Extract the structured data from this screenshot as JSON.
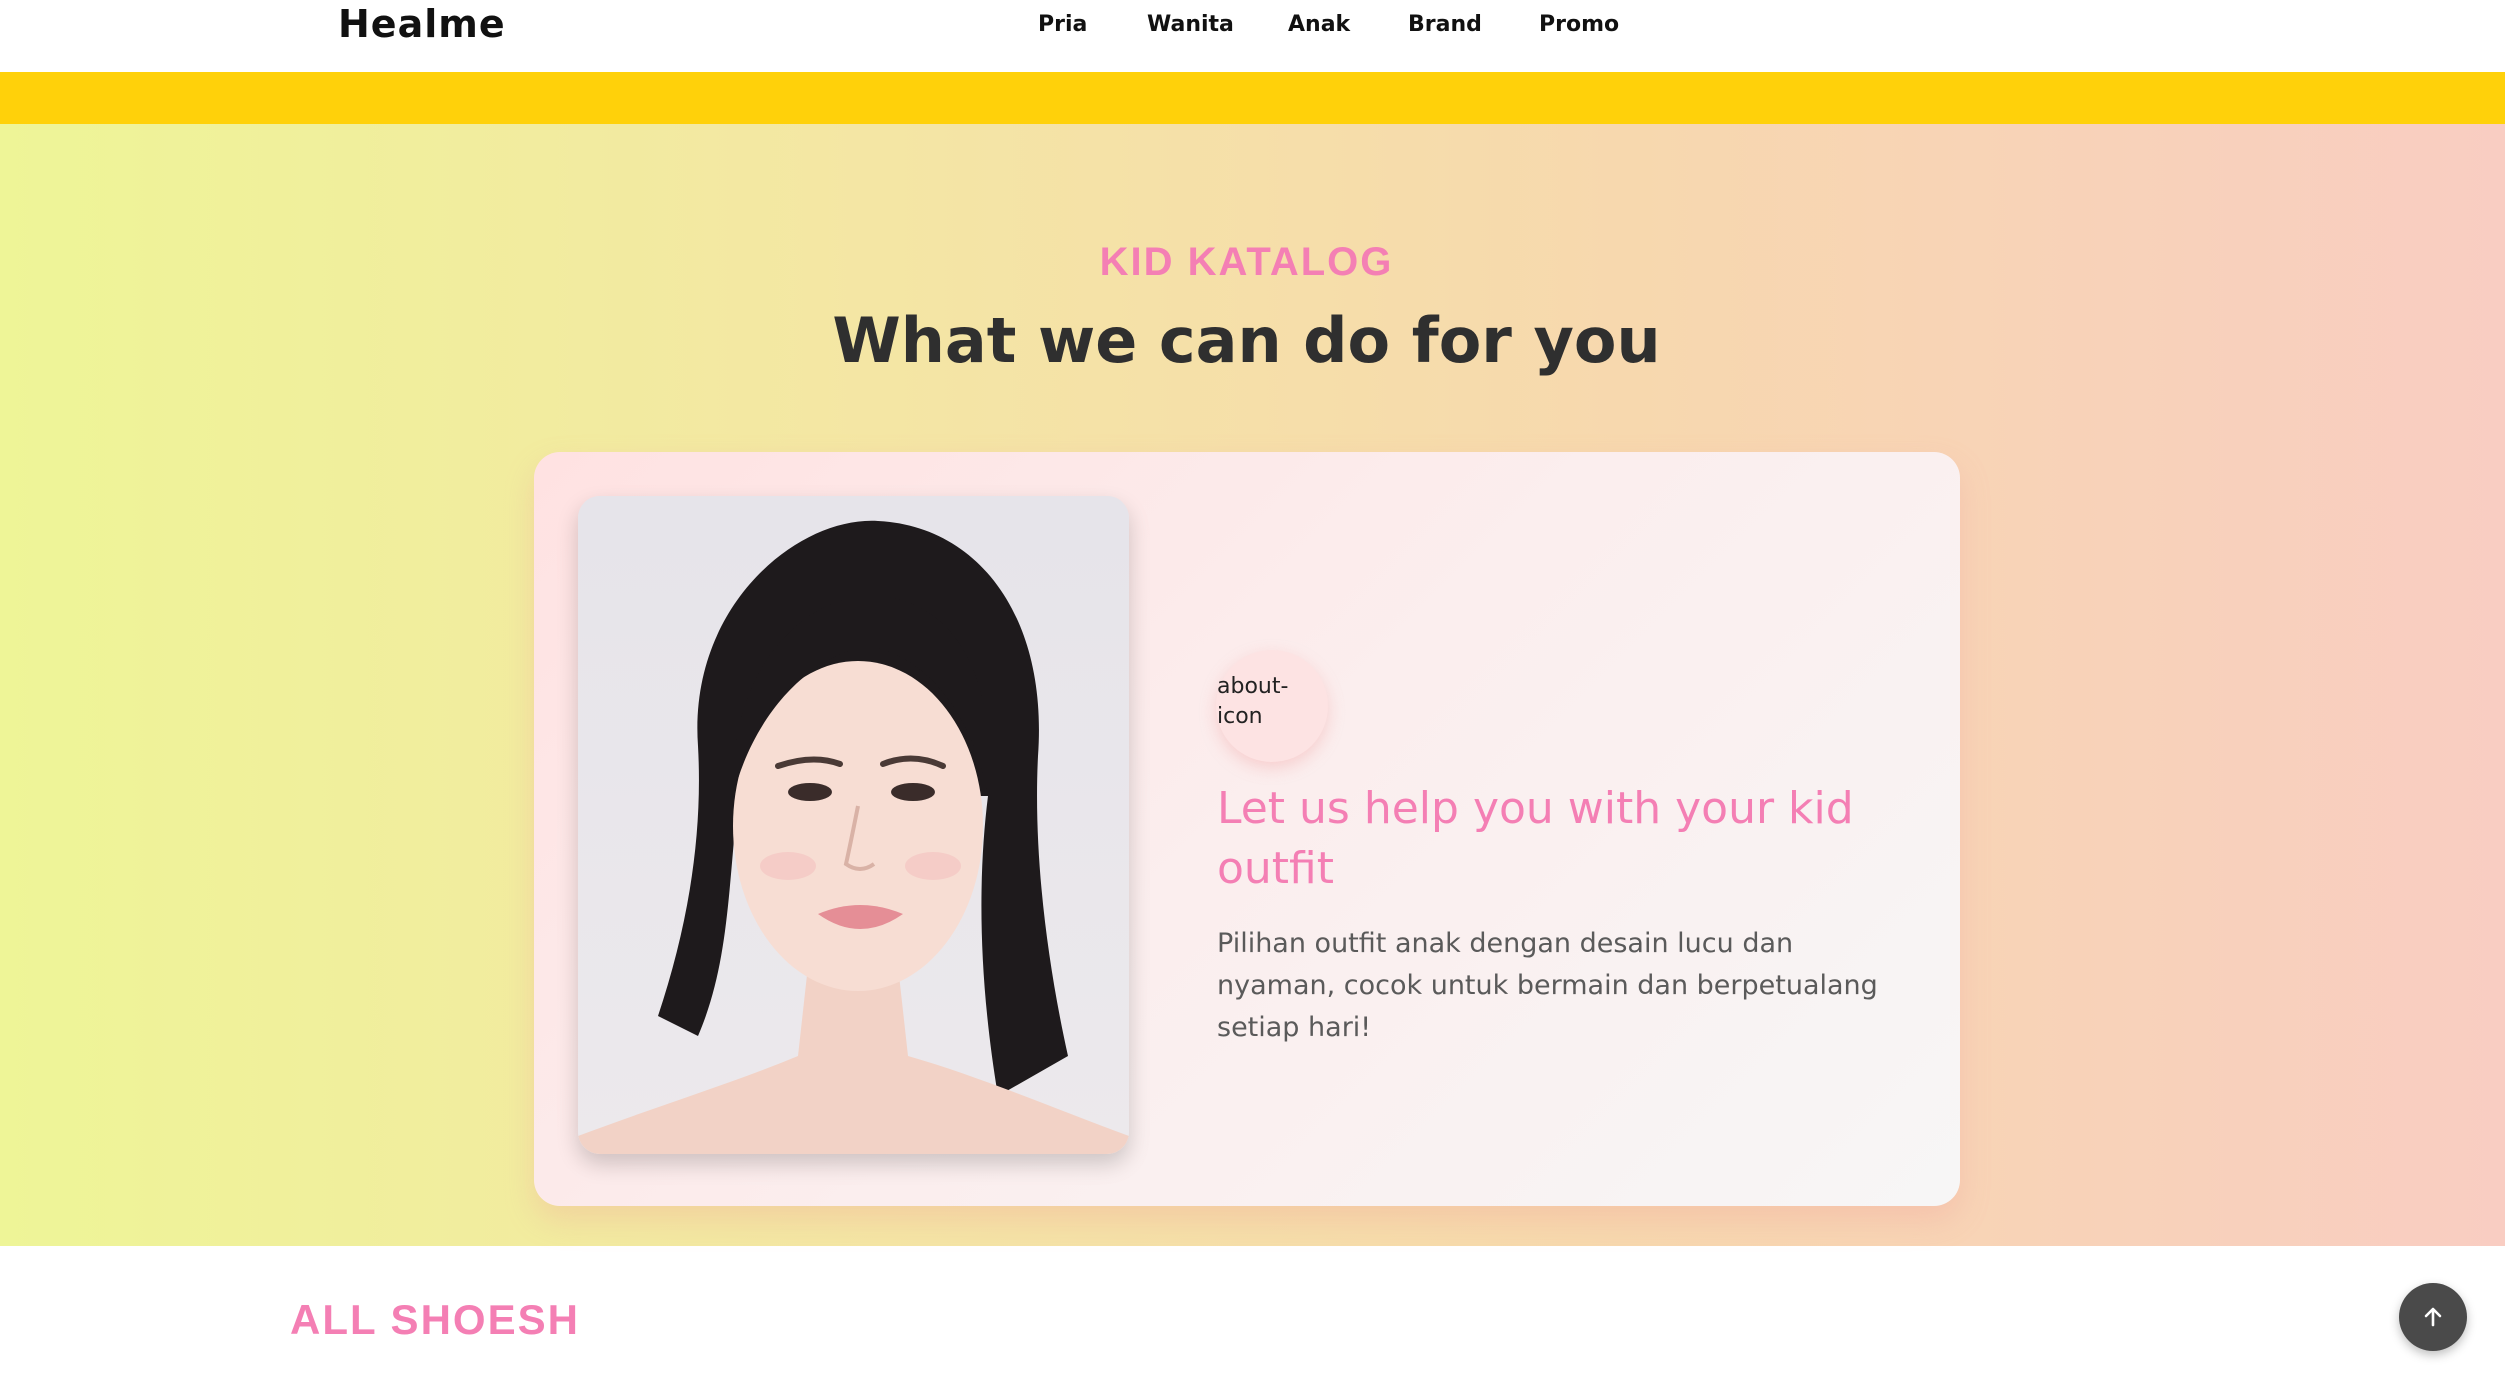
{
  "navbar": {
    "brand": "Healme",
    "links": [
      "Pria",
      "Wanita",
      "Anak",
      "Brand",
      "Promo"
    ]
  },
  "hero": {
    "eyebrow": "KID KATALOG",
    "title": "What we can do for you"
  },
  "card": {
    "icon_alt": "about-icon",
    "heading": "Let us help you with your kid outfit",
    "description": "Pilihan outfit anak dengan desain lucu dan nyaman, cocok untuk bermain dan berpetualang setiap hari!"
  },
  "products": {
    "section_title": "ALL SHOESH"
  },
  "scroll_top": {
    "icon": "arrow-up-icon"
  },
  "colors": {
    "accent_yellow": "#ffd10a",
    "accent_pink": "#f47fb4",
    "title_dark": "#2f2f2f"
  }
}
